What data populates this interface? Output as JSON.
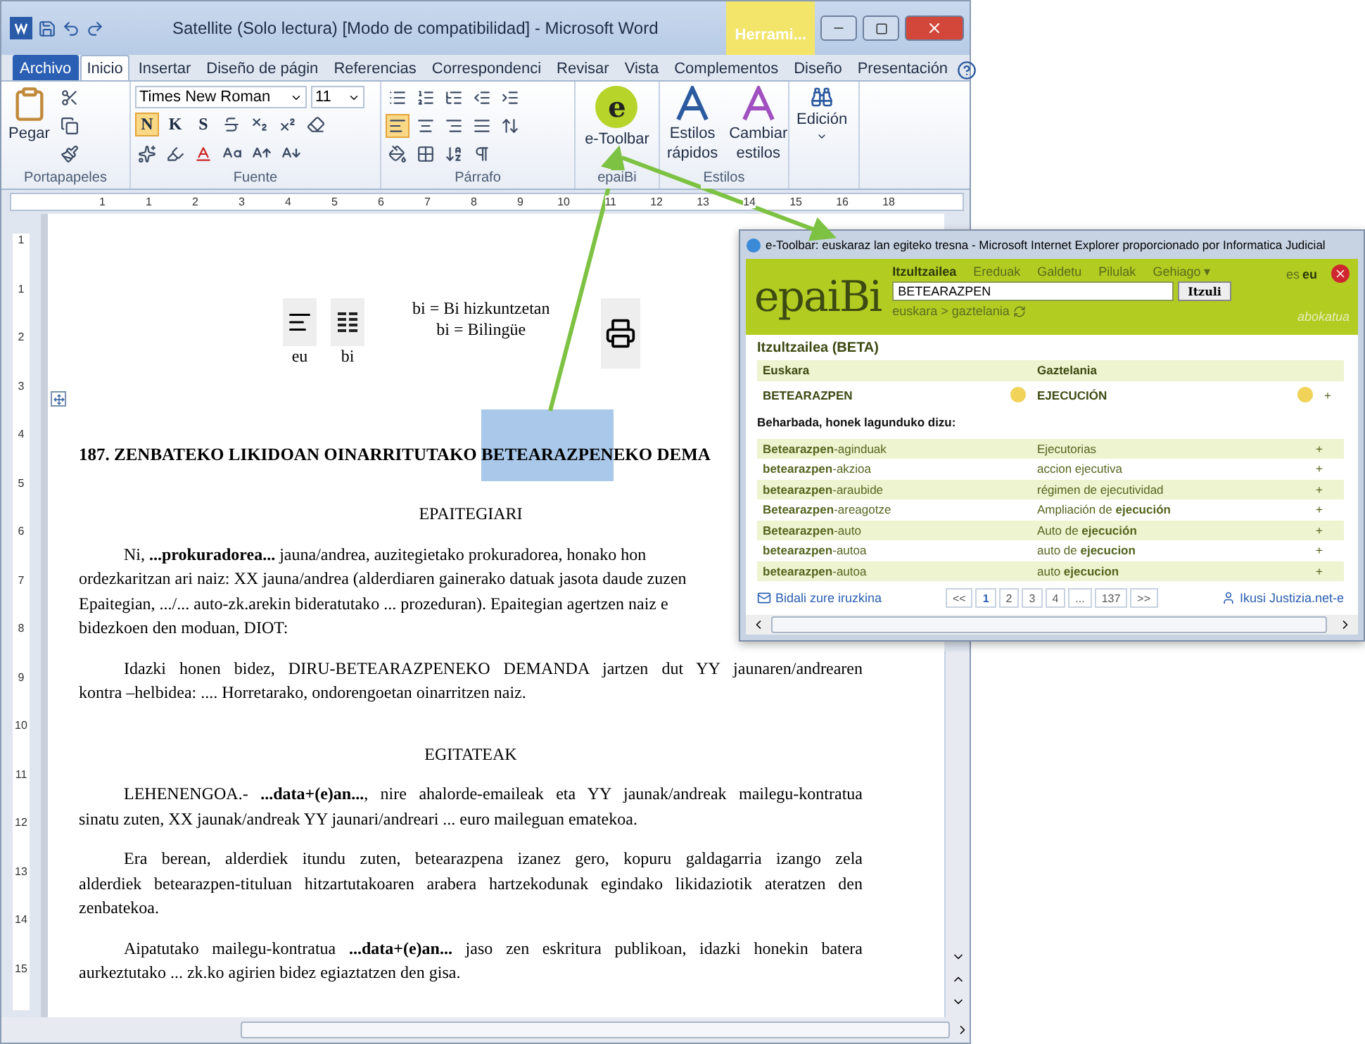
{
  "window": {
    "title": "Satellite (Solo lectura) [Modo de compatibilidad] - Microsoft Word",
    "context_tab": "Herrami..."
  },
  "ribbon_tabs": [
    {
      "label": "Archivo",
      "kind": "file",
      "selected": false
    },
    {
      "label": "Inicio",
      "kind": "tab",
      "selected": true
    },
    {
      "label": "Insertar",
      "kind": "tab",
      "selected": false
    },
    {
      "label": "Diseño de págin",
      "kind": "tab",
      "selected": false
    },
    {
      "label": "Referencias",
      "kind": "tab",
      "selected": false
    },
    {
      "label": "Correspondenci",
      "kind": "tab",
      "selected": false
    },
    {
      "label": "Revisar",
      "kind": "tab",
      "selected": false
    },
    {
      "label": "Vista",
      "kind": "tab",
      "selected": false
    },
    {
      "label": "Complementos",
      "kind": "tab",
      "selected": false
    },
    {
      "label": "Diseño",
      "kind": "tab",
      "selected": false
    },
    {
      "label": "Presentación",
      "kind": "tab",
      "selected": false
    }
  ],
  "clipboard": {
    "paste": "Pegar",
    "group": "Portapapeles"
  },
  "font": {
    "name": "Times New Roman",
    "size": "11",
    "group": "Fuente",
    "styles": [
      {
        "label": "N",
        "selected": true
      },
      {
        "label": "K",
        "selected": false
      },
      {
        "label": "S",
        "selected": false
      }
    ]
  },
  "paragraph": {
    "group": "Párrafo",
    "alignments": [
      {
        "selected": true
      },
      {
        "selected": false
      },
      {
        "selected": false
      },
      {
        "selected": false
      }
    ]
  },
  "etoolbar": {
    "letter": "e",
    "label": "e-Toolbar",
    "group": "epaiBi"
  },
  "styles": {
    "quick": [
      "Estilos",
      "rápidos"
    ],
    "change": [
      "Cambiar",
      "estilos"
    ],
    "group": "Estilos"
  },
  "editing": {
    "label": "Edición"
  },
  "ruler": {
    "horizontal": [
      "1",
      "1",
      "2",
      "3",
      "4",
      "5",
      "6",
      "7",
      "8",
      "9",
      "10",
      "11",
      "12",
      "13",
      "14",
      "15",
      "16",
      "18"
    ],
    "vertical": [
      "1",
      "1",
      "2",
      "3",
      "4",
      "5",
      "6",
      "7",
      "8",
      "9",
      "10",
      "11",
      "12",
      "13",
      "14",
      "15"
    ]
  },
  "document": {
    "views": [
      {
        "label": "eu",
        "kind": "single"
      },
      {
        "label": "bi",
        "kind": "double"
      }
    ],
    "legend": [
      "bi = Bi hizkuntzetan",
      "bi = Bilingüe"
    ],
    "heading": {
      "before": "187. ZENBATEKO LIKIDOAN OINARRITUTAKO ",
      "highlighted": "BETEARAZPEN",
      "after": "EKO DEMA"
    },
    "paragraphs": [
      {
        "kind": "center",
        "lines": [
          "EPAITEGIARI"
        ]
      },
      {
        "kind": "cut",
        "lines": [
          "Ni, **...prokuradorea...** jauna/andrea, auzitegietako prokuradorea, honako hon",
          "ordezkaritzan ari naiz: XX jauna/andrea (alderdiaren gainerako datuak jasota daude zuzen",
          "Epaitegian, .../... auto-zk.arekin bideratutako ... prozeduran). Epaitegian agertzen naiz e",
          "bidezkoen den moduan, DIOT:"
        ]
      },
      {
        "kind": "body",
        "lines": [
          "Idazki honen bidez, DIRU-BETEARAZPENEKO DEMANDA jartzen dut YY jaunaren/andrearen",
          "kontra –helbidea: .... Horretarako, ondorengoetan oinarritzen naiz."
        ]
      },
      {
        "kind": "center",
        "lines": [
          "EGITATEAK"
        ]
      },
      {
        "kind": "body",
        "lines": [
          "LEHENENGOA.- **...data+(e)an...**, nire ahalorde-emaileak eta YY jaunak/andreak mailegu-kontratua",
          "sinatu zuten, XX jaunak/andreak YY jaunari/andreari ... euro maileguan ematekoa."
        ]
      },
      {
        "kind": "body",
        "lines": [
          "Era berean, alderdiek itundu zuten, betearazpena izanez gero, kopuru galdagarria izango zela",
          "alderdiek betearazpen-tituluan hitzartutakoaren arabera hartzekodunak egindako likidaziotik ateratzen den",
          "zenbatekoa."
        ]
      },
      {
        "kind": "body",
        "lines": [
          "Aipatutako mailegu-kontratua **...data+(e)an...** jaso zen eskritura publikoan, idazki honekin batera",
          "aurkeztutako ... zk.ko agirien bidez egiaztatzen den gisa."
        ]
      }
    ]
  },
  "browser": {
    "title": "e-Toolbar: euskaraz lan egiteko tresna - Microsoft Internet Explorer proporcionado por Informatica Judicial",
    "logo": "epaiBi",
    "nav": [
      {
        "label": "Itzultzailea",
        "selected": true
      },
      {
        "label": "Ereduak",
        "selected": false
      },
      {
        "label": "Galdetu",
        "selected": false
      },
      {
        "label": "Pilulak",
        "selected": false
      },
      {
        "label": "Gehiago ▾",
        "selected": false
      }
    ],
    "query": "BETEARAZPEN",
    "translate": "Itzuli",
    "direction": "euskara > gaztelania",
    "languages": [
      {
        "label": "es",
        "selected": false
      },
      {
        "label": "eu",
        "selected": true
      }
    ],
    "user": "abokatua",
    "section": "Itzultzailea (BETA)",
    "columns": [
      "Euskara",
      "Gaztelania"
    ],
    "result": {
      "source": "BETEARAZPEN",
      "target": "EJECUCIÓN",
      "add": "+"
    },
    "suggest_title": "Beharbada, honek lagunduko dizu:",
    "rows": [
      {
        "source": "**Betearazpen**-aginduak",
        "target": "Ejecutorias",
        "add": "+"
      },
      {
        "source": "**betearazpen**-akzioa",
        "target": "accion ejecutiva",
        "add": "+"
      },
      {
        "source": "**betearazpen**-araubide",
        "target": "régimen de ejecutividad",
        "add": "+"
      },
      {
        "source": "**Betearazpen**-areagotze",
        "target": "Ampliación de **ejecución**",
        "add": "+"
      },
      {
        "source": "**Betearazpen**-auto",
        "target": "Auto de **ejecución**",
        "add": "+"
      },
      {
        "source": "**betearazpen**-autoa",
        "target": "auto de **ejecucion**",
        "add": "+"
      },
      {
        "source": "**betearazpen**-autoa",
        "target": "auto **ejecucion**",
        "add": "+"
      }
    ],
    "feedback": "Bidali zure iruzkina",
    "pages": [
      {
        "label": "<<",
        "selected": false
      },
      {
        "label": "1",
        "selected": true
      },
      {
        "label": "2",
        "selected": false
      },
      {
        "label": "3",
        "selected": false
      },
      {
        "label": "4",
        "selected": false
      },
      {
        "label": "...",
        "selected": false
      },
      {
        "label": "137",
        "selected": false
      },
      {
        "label": ">>",
        "selected": false
      }
    ],
    "more": "Ikusi Justizia.net-e"
  }
}
